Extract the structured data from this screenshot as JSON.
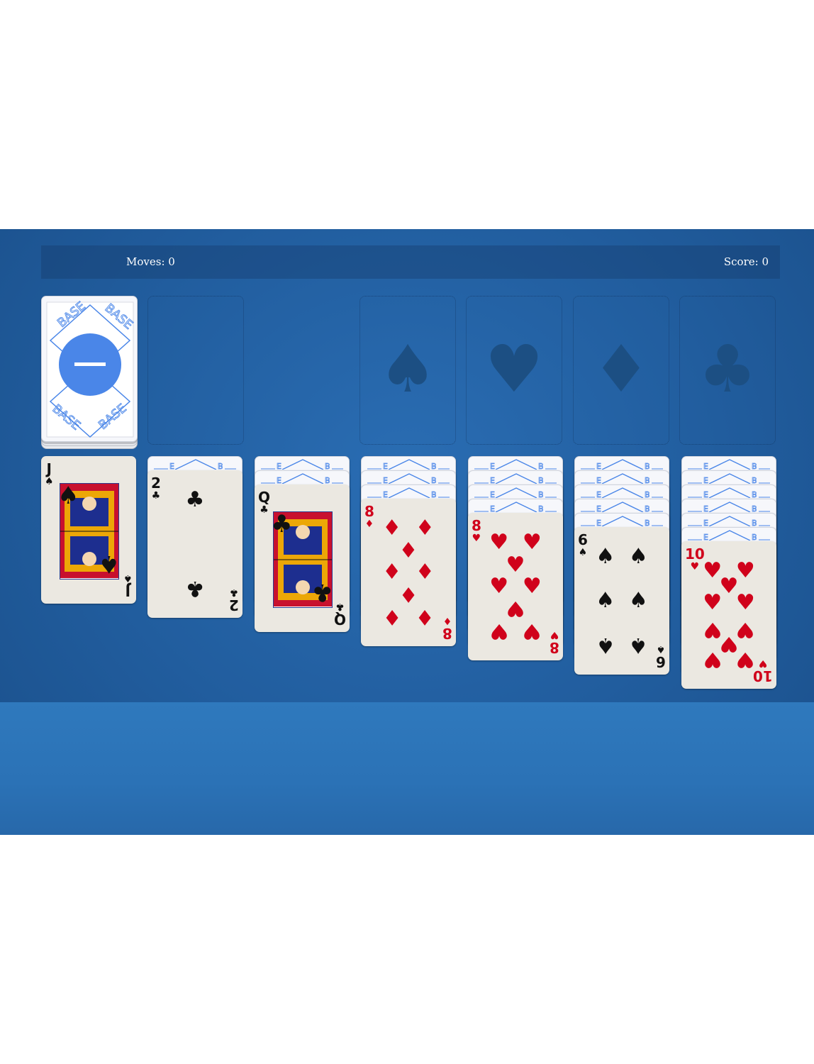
{
  "status": {
    "moves": "Moves: 0",
    "score": "Score: 0"
  },
  "stock": {
    "brand": "BASE",
    "cards_remaining": true
  },
  "foundations": [
    {
      "suit": "spades",
      "glyph": "♠"
    },
    {
      "suit": "hearts",
      "glyph": "♥"
    },
    {
      "suit": "diamonds",
      "glyph": "♦"
    },
    {
      "suit": "clubs",
      "glyph": "♣"
    }
  ],
  "tableau": [
    {
      "face_down": 0,
      "top": {
        "rank": "J",
        "suit": "♠",
        "color": "black",
        "type": "face"
      }
    },
    {
      "face_down": 1,
      "top": {
        "rank": "2",
        "suit": "♣",
        "color": "black",
        "type": "pip"
      }
    },
    {
      "face_down": 2,
      "top": {
        "rank": "Q",
        "suit": "♣",
        "color": "black",
        "type": "face"
      }
    },
    {
      "face_down": 3,
      "top": {
        "rank": "8",
        "suit": "♦",
        "color": "red",
        "type": "pip"
      }
    },
    {
      "face_down": 4,
      "top": {
        "rank": "8",
        "suit": "♥",
        "color": "red",
        "type": "pip"
      }
    },
    {
      "face_down": 5,
      "top": {
        "rank": "6",
        "suit": "♠",
        "color": "black",
        "type": "pip"
      }
    },
    {
      "face_down": 6,
      "top": {
        "rank": "10",
        "suit": "♥",
        "color": "red",
        "type": "pip"
      }
    }
  ],
  "colors": {
    "felt": "#215d9e",
    "red_suit": "#d0021b",
    "black_suit": "#111111",
    "card_back_accent": "#4a86e8"
  }
}
